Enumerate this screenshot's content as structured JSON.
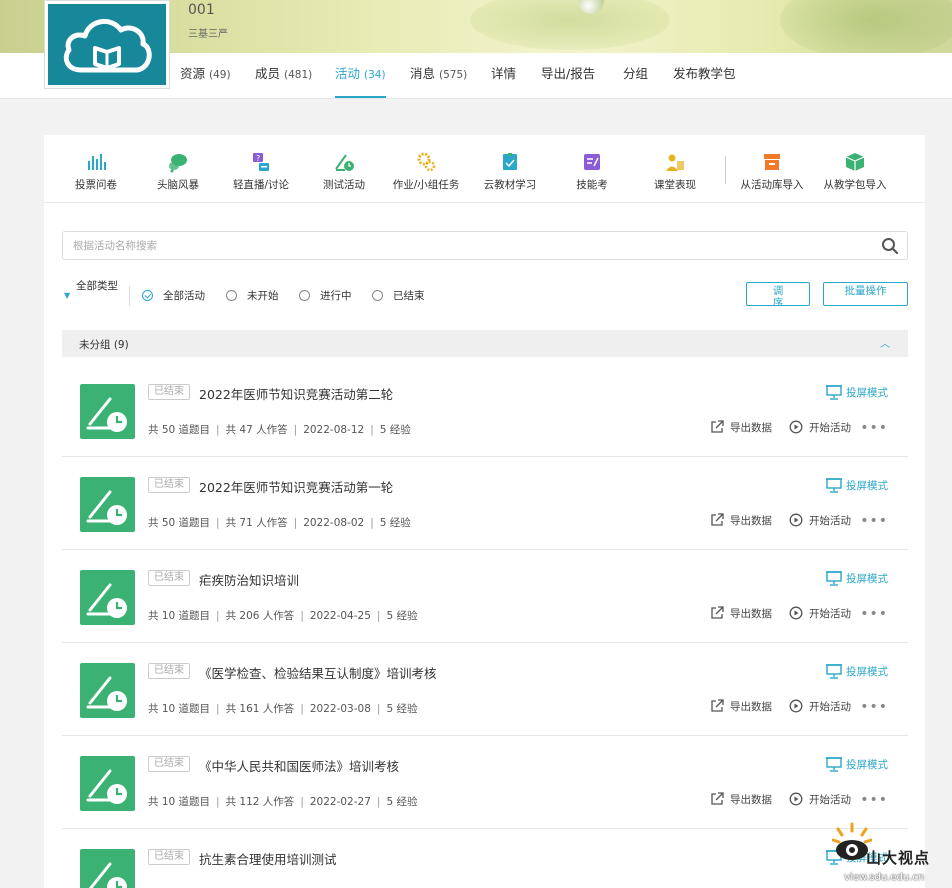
{
  "course": {
    "title": "001",
    "subtitle": "三基三严"
  },
  "main_nav": [
    {
      "label": "资源",
      "count": "(49)"
    },
    {
      "label": "成员",
      "count": "(481)"
    },
    {
      "label": "活动",
      "count": "(34)",
      "active": true
    },
    {
      "label": "消息",
      "count": "(575)"
    },
    {
      "label": "详情",
      "count": ""
    },
    {
      "label": "导出/报告",
      "count": ""
    },
    {
      "label": "分组",
      "count": ""
    },
    {
      "label": "发布教学包",
      "count": ""
    }
  ],
  "toolbar": [
    {
      "label": "投票问卷",
      "icon": "bar-chart-icon",
      "color": "#2aa7c9"
    },
    {
      "label": "头脑风暴",
      "icon": "brainstorm-icon",
      "color": "#3bb273"
    },
    {
      "label": "轻直播/讨论",
      "icon": "discussion-icon",
      "color": "#8a5cd6"
    },
    {
      "label": "测试活动",
      "icon": "test-icon",
      "color": "#3bb273"
    },
    {
      "label": "作业/小组任务",
      "icon": "gears-icon",
      "color": "#e8b21e"
    },
    {
      "label": "云教材学习",
      "icon": "book-icon",
      "color": "#2aa7c9"
    },
    {
      "label": "技能考",
      "icon": "skill-icon",
      "color": "#8a5cd6"
    },
    {
      "label": "课堂表现",
      "icon": "performance-icon",
      "color": "#e8b21e"
    },
    {
      "label": "从活动库导入",
      "icon": "library-icon",
      "color": "#f07a2a"
    },
    {
      "label": "从教学包导入",
      "icon": "package-icon",
      "color": "#3bb273"
    }
  ],
  "search": {
    "placeholder": "根据活动名称搜索"
  },
  "filter": {
    "type_label": "全部类型",
    "options": [
      "全部活动",
      "未开始",
      "进行中",
      "已结束"
    ],
    "selected": "全部活动",
    "sort_button": "调序",
    "batch_button": "批量操作"
  },
  "group": {
    "label": "未分组 (9)"
  },
  "item_actions": {
    "project": "投屏模式",
    "export": "导出数据",
    "start": "开始活动"
  },
  "activities": [
    {
      "status": "已结束",
      "title": "2022年医师节知识竞赛活动第二轮",
      "questions": "共 50 道题目",
      "participants": "共 47 人作答",
      "date": "2022-08-12",
      "exp": "5 经验"
    },
    {
      "status": "已结束",
      "title": "2022年医师节知识竞赛活动第一轮",
      "questions": "共 50 道题目",
      "participants": "共 71 人作答",
      "date": "2022-08-02",
      "exp": "5 经验"
    },
    {
      "status": "已结束",
      "title": "疟疾防治知识培训",
      "questions": "共 10 道题目",
      "participants": "共 206 人作答",
      "date": "2022-04-25",
      "exp": "5 经验"
    },
    {
      "status": "已结束",
      "title": "《医学检查、检验结果互认制度》培训考核",
      "questions": "共 10 道题目",
      "participants": "共 161 人作答",
      "date": "2022-03-08",
      "exp": "5 经验"
    },
    {
      "status": "已结束",
      "title": "《中华人民共和国医师法》培训考核",
      "questions": "共 10 道题目",
      "participants": "共 112 人作答",
      "date": "2022-02-27",
      "exp": "5 经验"
    },
    {
      "status": "已结束",
      "title": "抗生素合理使用培训测试",
      "questions": "",
      "participants": "",
      "date": "",
      "exp": ""
    }
  ],
  "watermark": {
    "text": "山大视点",
    "url": "view.sdu.edu.cn"
  }
}
